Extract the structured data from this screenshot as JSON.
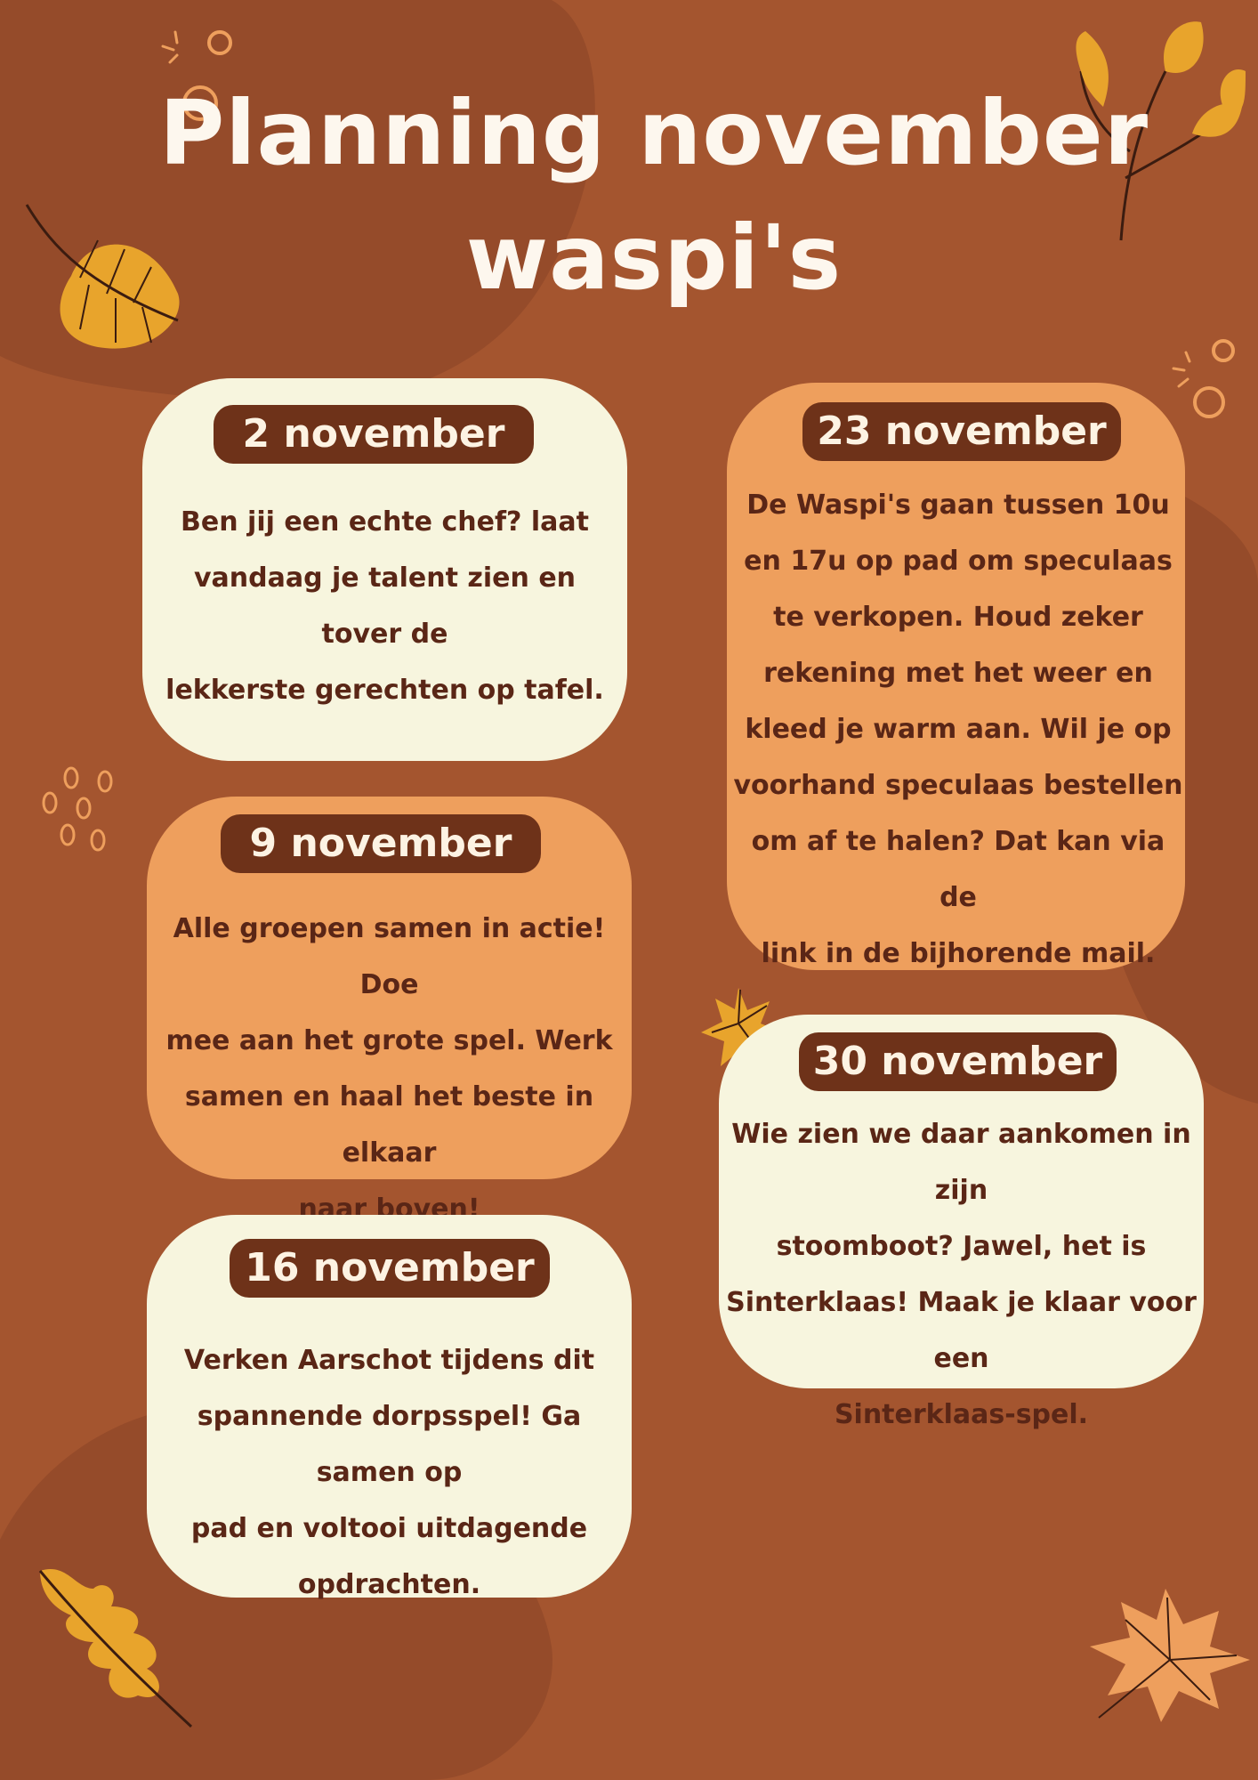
{
  "title": {
    "line1": "Planning november",
    "line2": "waspi's"
  },
  "events": [
    {
      "date": "2 november",
      "lines": [
        "Ben jij een echte chef? laat",
        "vandaag je talent zien en tover de",
        "lekkerste gerechten op tafel."
      ]
    },
    {
      "date": "9 november",
      "lines": [
        "Alle groepen samen in actie! Doe",
        "mee aan het grote spel. Werk",
        "samen en haal het beste in elkaar",
        "naar boven!"
      ]
    },
    {
      "date": "16 november",
      "lines": [
        "Verken Aarschot tijdens dit",
        "spannende dorpsspel! Ga samen op",
        "pad en voltooi uitdagende",
        "opdrachten."
      ]
    },
    {
      "date": "23 november",
      "lines": [
        "De Waspi's gaan tussen 10u",
        "en 17u op pad om speculaas",
        "te verkopen. Houd zeker",
        "rekening met het weer en",
        "kleed je warm aan. Wil je op",
        "voorhand speculaas bestellen",
        "om af te halen? Dat kan via de",
        "link in de bijhorende mail."
      ]
    },
    {
      "date": "30 november",
      "lines": [
        "Wie zien we daar aankomen in zijn",
        "stoomboot? Jawel, het is",
        "Sinterklaas!  Maak je klaar voor een",
        "Sinterklaas-spel."
      ]
    }
  ],
  "decorations": [
    "leaf-icon",
    "maple-leaf-icon",
    "oak-leaf-icon",
    "branch-icon",
    "circles-icon",
    "dots-icon"
  ],
  "colors": {
    "background": "#a4552f",
    "blob": "#954b2a",
    "card_cream": "#f7f5de",
    "card_orange": "#ee9f5d",
    "pill": "#6e3219",
    "text_dark": "#5a2616",
    "title": "#fdf7ee"
  }
}
